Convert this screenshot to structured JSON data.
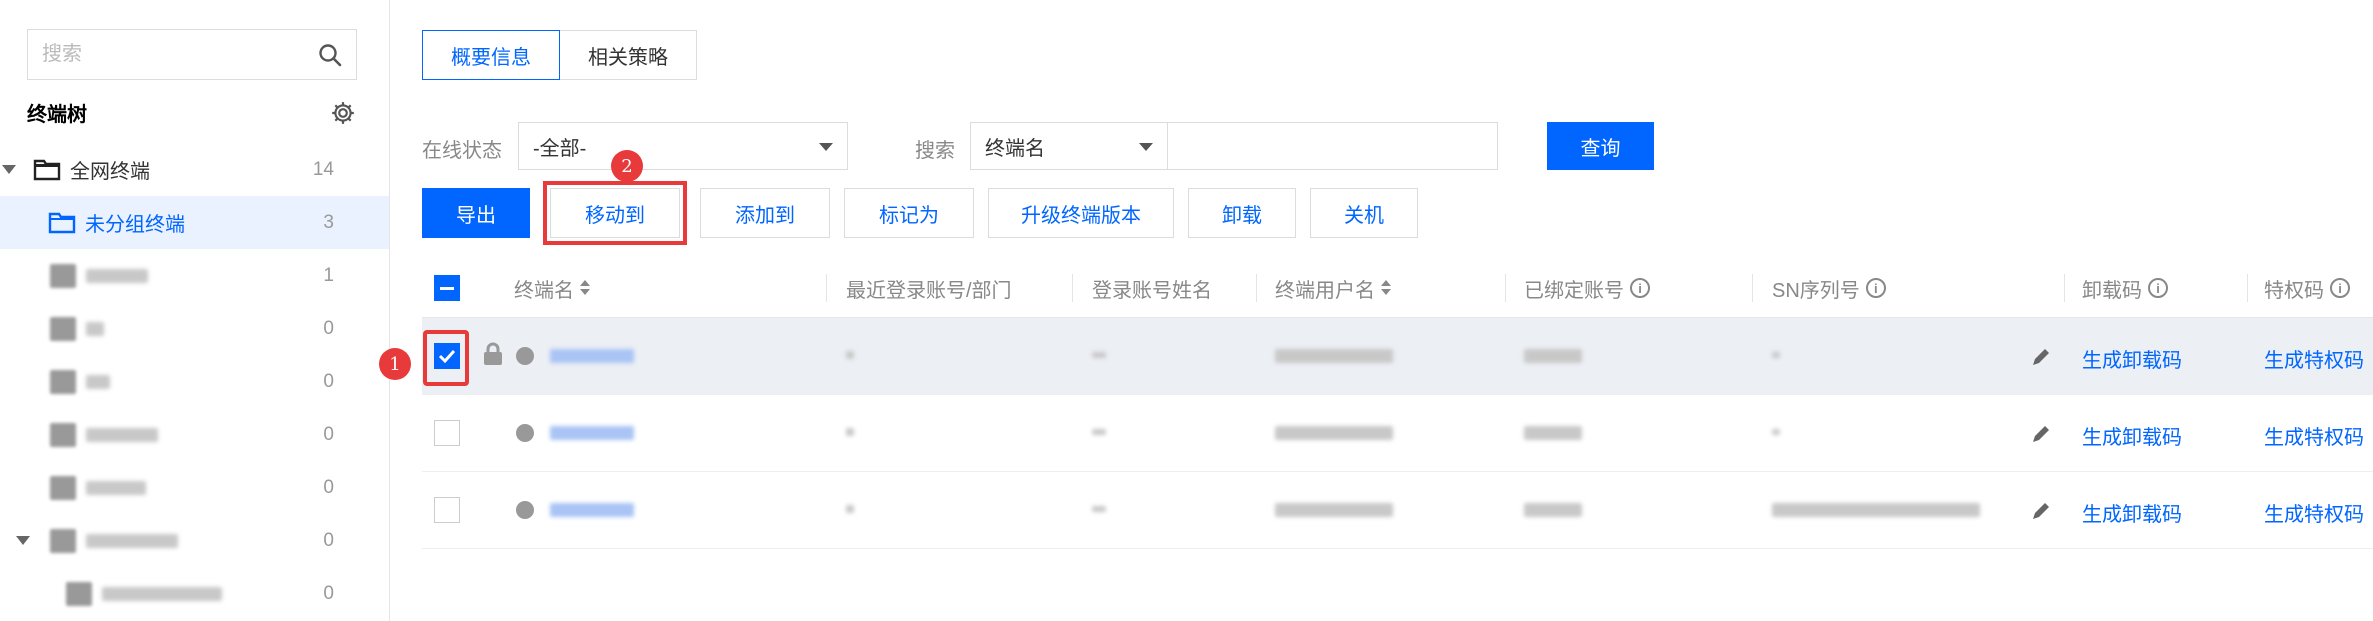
{
  "sidebar": {
    "search_placeholder": "搜索",
    "tree_title": "终端树",
    "items": [
      {
        "label": "全网终端",
        "count": "14"
      },
      {
        "label": "未分组终端",
        "count": "3"
      },
      {
        "label": "",
        "count": "1"
      },
      {
        "label": "",
        "count": "0"
      },
      {
        "label": "",
        "count": "0"
      },
      {
        "label": "",
        "count": "0"
      },
      {
        "label": "",
        "count": "0"
      },
      {
        "label": "",
        "count": "0"
      },
      {
        "label": "",
        "count": "0"
      }
    ]
  },
  "tabs": [
    {
      "label": "概要信息",
      "active": true
    },
    {
      "label": "相关策略",
      "active": false
    }
  ],
  "filters": {
    "status_label": "在线状态",
    "status_value": "-全部-",
    "search_label": "搜索",
    "search_field_value": "终端名",
    "search_text": "",
    "query_button": "查询"
  },
  "toolbar": {
    "export": "导出",
    "move_to": "移动到",
    "add_to": "添加到",
    "mark_as": "标记为",
    "upgrade": "升级终端版本",
    "uninstall": "卸载",
    "shutdown": "关机"
  },
  "table": {
    "headers": [
      "终端名",
      "最近登录账号/部门",
      "登录账号姓名",
      "终端用户名",
      "已绑定账号",
      "SN序列号",
      "卸载码",
      "特权码"
    ],
    "rows": [
      {
        "checked": true,
        "uninstall_code": "生成卸载码",
        "privilege_code": "生成特权码"
      },
      {
        "checked": false,
        "uninstall_code": "生成卸载码",
        "privilege_code": "生成特权码"
      },
      {
        "checked": false,
        "uninstall_code": "生成卸载码",
        "privilege_code": "生成特权码"
      }
    ]
  },
  "annotations": {
    "step1": "1",
    "step2": "2"
  },
  "colors": {
    "accent": "#0066ff",
    "highlight": "#e83a3a",
    "selected_row": "#eceff4",
    "selected_tree": "#eaf1ff"
  }
}
